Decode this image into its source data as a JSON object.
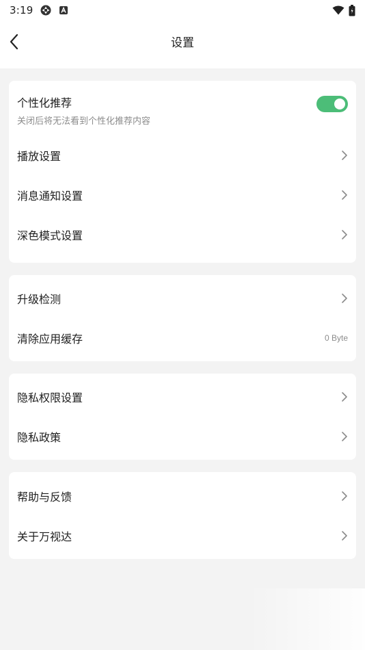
{
  "status_bar": {
    "time": "3:19",
    "icons": [
      "sync-icon",
      "a-badge-icon",
      "wifi-icon",
      "battery-icon"
    ]
  },
  "header": {
    "title": "设置",
    "back_icon": "chevron-left-icon"
  },
  "colors": {
    "accent": "#4cbd78",
    "background": "#f3f3f3",
    "card": "#ffffff",
    "secondary_text": "#8c8c8c"
  },
  "group1": {
    "personal_recommend": {
      "label": "个性化推荐",
      "sub": "关闭后将无法看到个性化推荐内容",
      "enabled": true
    },
    "playback": "播放设置",
    "notifications": "消息通知设置",
    "dark_mode": "深色模式设置"
  },
  "group2": {
    "upgrade": "升级检测",
    "clear_cache": "清除应用缓存",
    "cache_size": "0 Byte"
  },
  "group3": {
    "privacy_permissions": "隐私权限设置",
    "privacy_policy": "隐私政策"
  },
  "group4": {
    "help_feedback": "帮助与反馈",
    "about": "关于万视达"
  }
}
